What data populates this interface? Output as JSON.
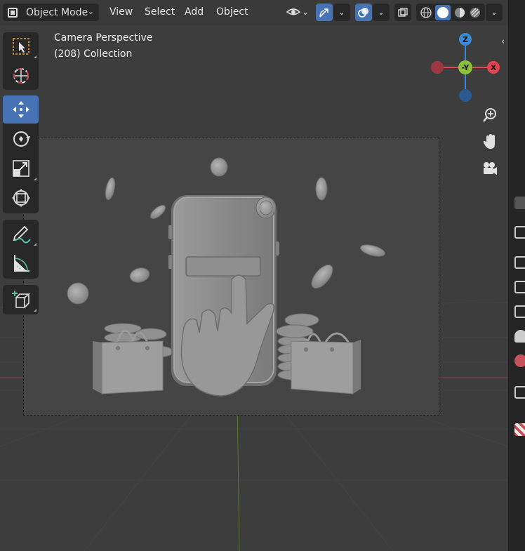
{
  "header": {
    "mode_label": "Object Mode",
    "menus": [
      "View",
      "Select",
      "Add",
      "Object"
    ],
    "icons": [
      "object-mode-icon",
      "visibility-icon",
      "transform-pivot-icon",
      "overlay-icon",
      "xray-icon",
      "wireframe-shading-icon",
      "solid-shading-icon",
      "material-shading-icon",
      "rendered-shading-icon"
    ]
  },
  "viewport": {
    "camera_label": "Camera Perspective",
    "collection_label": "(208) Collection"
  },
  "gizmo": {
    "z_label": "Z",
    "y_label": "-Y",
    "x_label": "X",
    "colors": {
      "x": "#e5434f",
      "y": "#8bc13a",
      "z": "#3b8ad8"
    }
  },
  "toolbar": {
    "tools": [
      "select-box",
      "cursor",
      "move",
      "rotate",
      "scale",
      "transform",
      "annotate",
      "measure",
      "add-cube"
    ],
    "active": "move",
    "active_color": "#4772b3"
  },
  "nav": [
    "zoom-icon",
    "pan-hand-icon",
    "camera-view-icon"
  ]
}
